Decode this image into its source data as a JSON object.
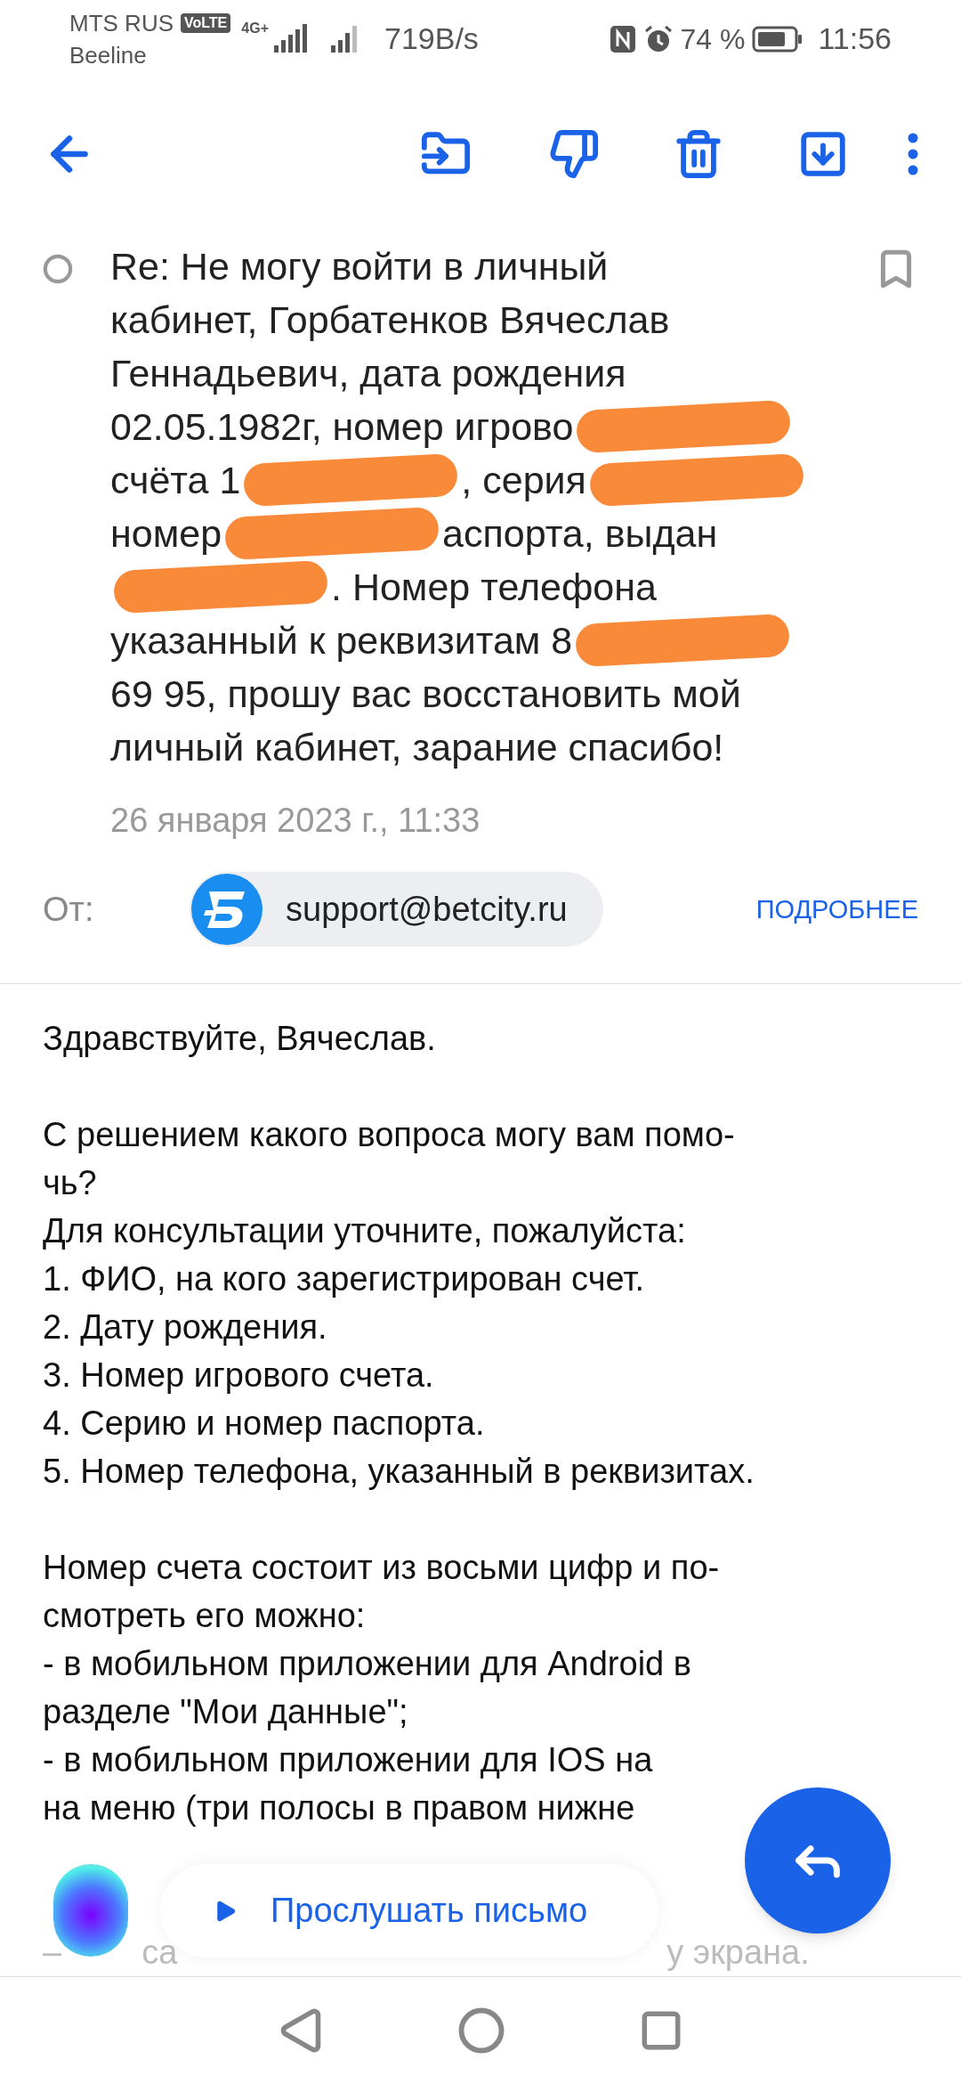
{
  "status_bar": {
    "carrier_1": "MTS RUS",
    "volte": "VoLTE",
    "carrier_2": "Beeline",
    "network": "4G+",
    "speed": "719B/s",
    "battery": "74 %",
    "time": "11:56"
  },
  "subject": {
    "lines": [
      [
        {
          "kind": "text",
          "text": "Re: Не могу войти в личный"
        }
      ],
      [
        {
          "kind": "text",
          "text": "кабинет, Горбатенков Вячеслав"
        }
      ],
      [
        {
          "kind": "text",
          "text": "Геннадьевич, дата рождения"
        }
      ],
      [
        {
          "kind": "text",
          "text": "02.05.1982г, номер игрово"
        },
        {
          "kind": "redacted"
        }
      ],
      [
        {
          "kind": "text",
          "text": "счёта 1"
        },
        {
          "kind": "redacted"
        },
        {
          "kind": "text",
          "text": ", серия"
        },
        {
          "kind": "redacted"
        }
      ],
      [
        {
          "kind": "text",
          "text": "номер"
        },
        {
          "kind": "redacted"
        },
        {
          "kind": "text",
          "text": "аспорта, выдан"
        }
      ],
      [
        {
          "kind": "redacted"
        },
        {
          "kind": "text",
          "text": ". Номер телефона"
        }
      ],
      [
        {
          "kind": "text",
          "text": "указанный к реквизитам 8"
        },
        {
          "kind": "redacted"
        }
      ],
      [
        {
          "kind": "text",
          "text": "69 95, прошу вас восстановить мой"
        }
      ],
      [
        {
          "kind": "text",
          "text": "личный кабинет, зарание спасибо!"
        }
      ]
    ]
  },
  "date": "26 января 2023 г., 11:33",
  "from": {
    "label": "От:",
    "sender": "support@betcity.ru",
    "details": "ПОДРОБНЕЕ"
  },
  "body": {
    "paragraphs": [
      [
        "Здравствуйте, Вячеслав."
      ],
      [
        "С решением какого вопроса могу вам помо-",
        "чь?",
        "Для консультации уточните, пожалуйста:",
        "1. ФИО, на кого зарегистрирован счет.",
        "2. Дату рождения.",
        "3. Номер игрового счета.",
        "4. Серию и номер паспорта.",
        "5. Номер телефона, указанный в реквизитах."
      ],
      [
        "Номер счета состоит из восьми цифр и по-",
        "смотреть его можно:",
        "- в мобильном приложении для Android в",
        "разделе \"Мои данные\";",
        "- в мобильном приложении для IOS на",
        "на меню (три полосы в правом нижне"
      ]
    ],
    "covered_line": [
      "–",
      "са",
      "у экрана."
    ]
  },
  "listen_button": "Прослушать письмо"
}
